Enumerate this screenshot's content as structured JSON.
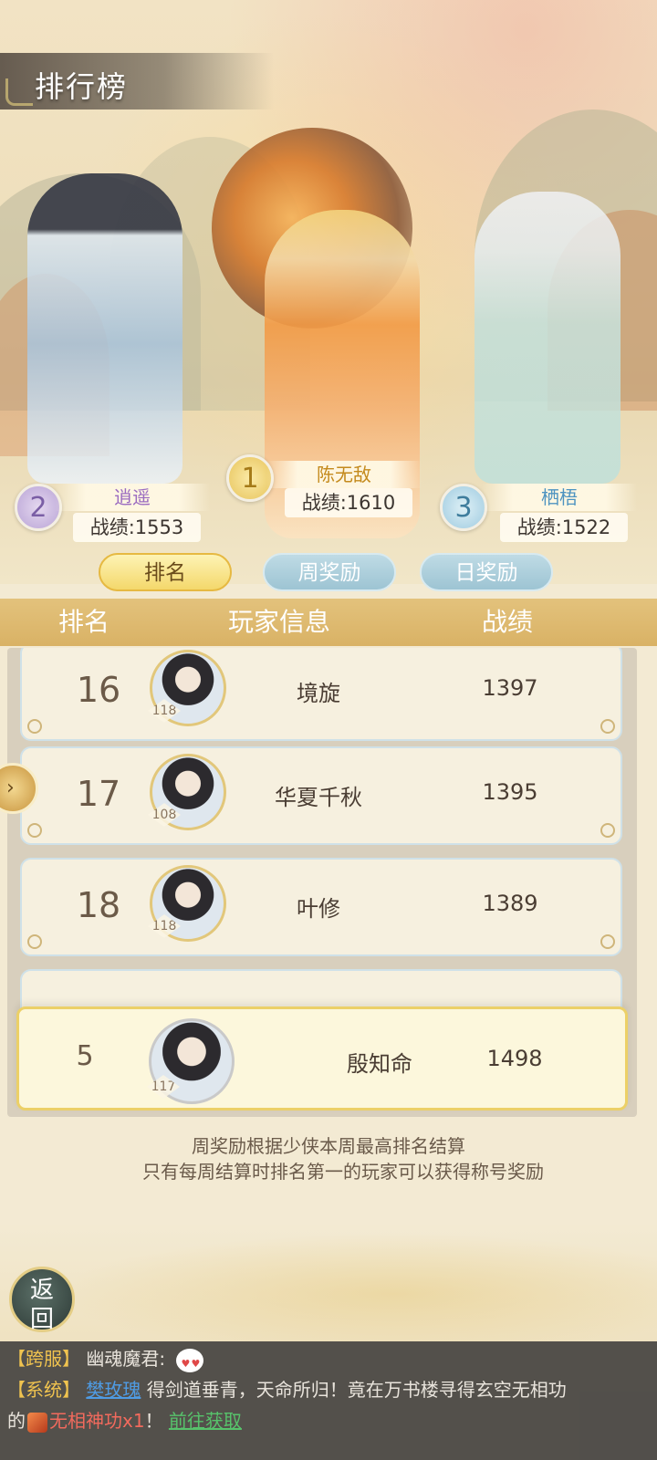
{
  "page": {
    "title": "排行榜"
  },
  "podium": [
    {
      "rank": "2",
      "name": "逍遥",
      "score": "战绩:1553"
    },
    {
      "rank": "1",
      "name": "陈无敌",
      "score": "战绩:1610"
    },
    {
      "rank": "3",
      "name": "栖梧",
      "score": "战绩:1522"
    }
  ],
  "tabs": {
    "rank": "排名",
    "weekly": "周奖励",
    "daily": "日奖励",
    "active": "rank"
  },
  "table_header": {
    "rank": "排名",
    "info": "玩家信息",
    "score": "战绩"
  },
  "rows": [
    {
      "rank": "16",
      "level": "118",
      "name": "境旋",
      "score": "1397"
    },
    {
      "rank": "17",
      "level": "108",
      "name": "华夏千秋",
      "score": "1395"
    },
    {
      "rank": "18",
      "level": "118",
      "name": "叶修",
      "score": "1389"
    }
  ],
  "my_row": {
    "rank": "5",
    "level": "117",
    "name": "殷知命",
    "score": "1498"
  },
  "notes": {
    "line1": "周奖励根据少侠本周最高排名结算",
    "line2": "只有每周结算时排名第一的玩家可以获得称号奖励"
  },
  "back_button": {
    "line1": "返",
    "line2": "回"
  },
  "chat": {
    "line1": {
      "tag": "【跨服】",
      "speaker": "幽魂魔君:",
      "emoji": "heart-eyes-emoji"
    },
    "line2": {
      "tag": "【系统】",
      "player": "樊玫瑰",
      "text": "得剑道垂青，天命所归！竟在万书楼寻得玄空无相功"
    },
    "line3": {
      "prefix": "的",
      "item": "无相神功x1",
      "suffix": "！",
      "link": "前往获取"
    }
  }
}
